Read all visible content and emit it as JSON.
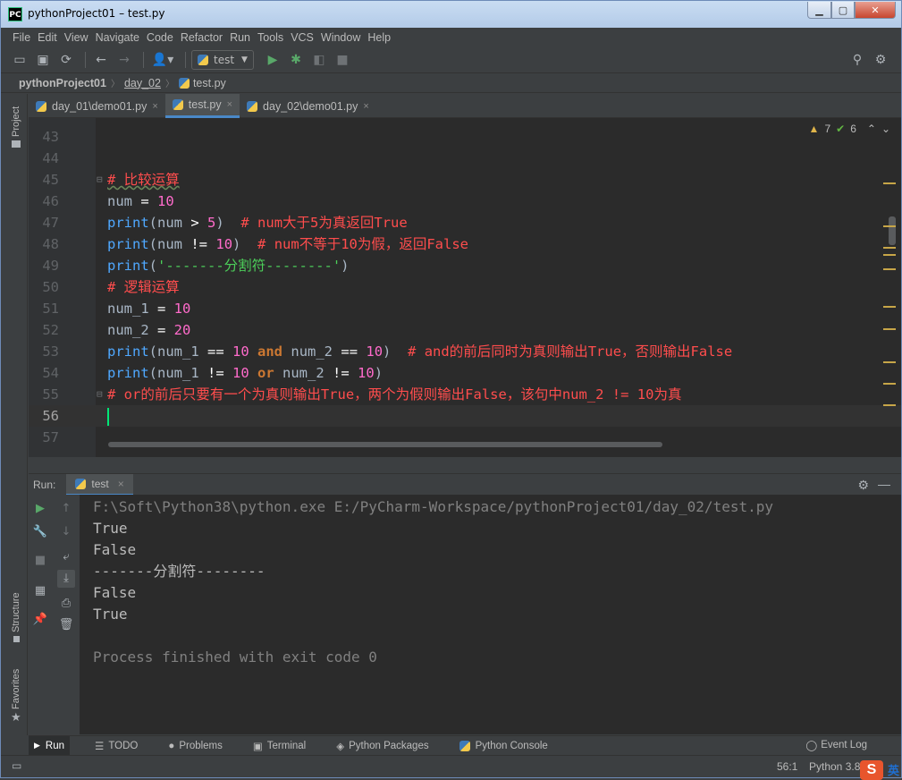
{
  "window": {
    "title": "pythonProject01 – test.py",
    "app_icon": "PC"
  },
  "menu": [
    {
      "label": "File"
    },
    {
      "label": "Edit"
    },
    {
      "label": "View"
    },
    {
      "label": "Navigate"
    },
    {
      "label": "Code"
    },
    {
      "label": "Refactor"
    },
    {
      "label": "Run"
    },
    {
      "label": "Tools"
    },
    {
      "label": "VCS"
    },
    {
      "label": "Window"
    },
    {
      "label": "Help"
    }
  ],
  "toolbar": {
    "run_config": "test"
  },
  "breadcrumb": {
    "project": "pythonProject01",
    "folder": "day_02",
    "file": "test.py"
  },
  "tabs": [
    {
      "label": "day_01\\demo01.py",
      "close": "×"
    },
    {
      "label": "test.py",
      "close": "×"
    },
    {
      "label": "day_02\\demo01.py",
      "close": "×"
    }
  ],
  "inspections": {
    "warnings": "7",
    "typos": "6"
  },
  "code_lines": [
    {
      "n": "43"
    },
    {
      "n": "44"
    },
    {
      "n": "45"
    },
    {
      "n": "46"
    },
    {
      "n": "47"
    },
    {
      "n": "48"
    },
    {
      "n": "49"
    },
    {
      "n": "50"
    },
    {
      "n": "51"
    },
    {
      "n": "52"
    },
    {
      "n": "53"
    },
    {
      "n": "54"
    },
    {
      "n": "55"
    },
    {
      "n": "56"
    },
    {
      "n": "57"
    }
  ],
  "code": {
    "l45": "# 比较运算",
    "l46_var": "num",
    "l46_op": " = ",
    "l46_num": "10",
    "l47_fn": "print",
    "l47_open": "(num ",
    "l47_op": ">",
    "l47_sp": " ",
    "l47_num": "5",
    "l47_close": ")  ",
    "l47_cm": "# num大于5为真返回True",
    "l48_fn": "print",
    "l48_open": "(num ",
    "l48_op": "!=",
    "l48_sp": " ",
    "l48_num": "10",
    "l48_close": ")  ",
    "l48_cm": "# num不等于10为假，返回False",
    "l49_fn": "print",
    "l49_open": "(",
    "l49_str": "'-------分割符--------'",
    "l49_close": ")",
    "l50": "# 逻辑运算",
    "l51_var": "num_1",
    "l51_op": " = ",
    "l51_num": "10",
    "l52_var": "num_2",
    "l52_op": " = ",
    "l52_num": "20",
    "l53_fn": "print",
    "l53_a": "(num_1 ",
    "l53_op1": "==",
    "l53_b": " ",
    "l53_n1": "10",
    "l53_kw": " and ",
    "l53_c": "num_2 ",
    "l53_op2": "==",
    "l53_d": " ",
    "l53_n2": "10",
    "l53_close": ")  ",
    "l53_cm": "# and的前后同时为真则输出True，否则输出False",
    "l54_fn": "print",
    "l54_a": "(num_1 ",
    "l54_op1": "!=",
    "l54_b": " ",
    "l54_n1": "10",
    "l54_kw": " or ",
    "l54_c": "num_2 ",
    "l54_op2": "!=",
    "l54_d": " ",
    "l54_n2": "10",
    "l54_close": ")",
    "l55": "# or的前后只要有一个为真则输出True，两个为假则输出False，该句中num_2 != 10为真"
  },
  "run": {
    "label": "Run:",
    "tab": "test",
    "output": [
      "F:\\Soft\\Python38\\python.exe E:/PyCharm-Workspace/pythonProject01/day_02/test.py",
      "True",
      "False",
      "-------分割符--------",
      "False",
      "True",
      "",
      "Process finished with exit code 0"
    ]
  },
  "bottom_tools": [
    {
      "label": "Run",
      "icon": "play-icon"
    },
    {
      "label": "TODO",
      "icon": "list-icon"
    },
    {
      "label": "Problems",
      "icon": "info-icon"
    },
    {
      "label": "Terminal",
      "icon": "terminal-icon"
    },
    {
      "label": "Python Packages",
      "icon": "layers-icon"
    },
    {
      "label": "Python Console",
      "icon": "python-icon"
    }
  ],
  "event_log": "Event Log",
  "status": {
    "position": "56:1",
    "interpreter": "Python 3.8",
    "ime": "英"
  },
  "side_labels": {
    "project": "Project",
    "structure": "Structure",
    "favorites": "Favorites"
  },
  "colors": {
    "accent": "#4a88c7",
    "editor_bg": "#2b2b2b",
    "comment": "#ff4d4d",
    "number": "#ff6bcb",
    "string": "#4ccf5a",
    "function": "#4fa8ff"
  }
}
